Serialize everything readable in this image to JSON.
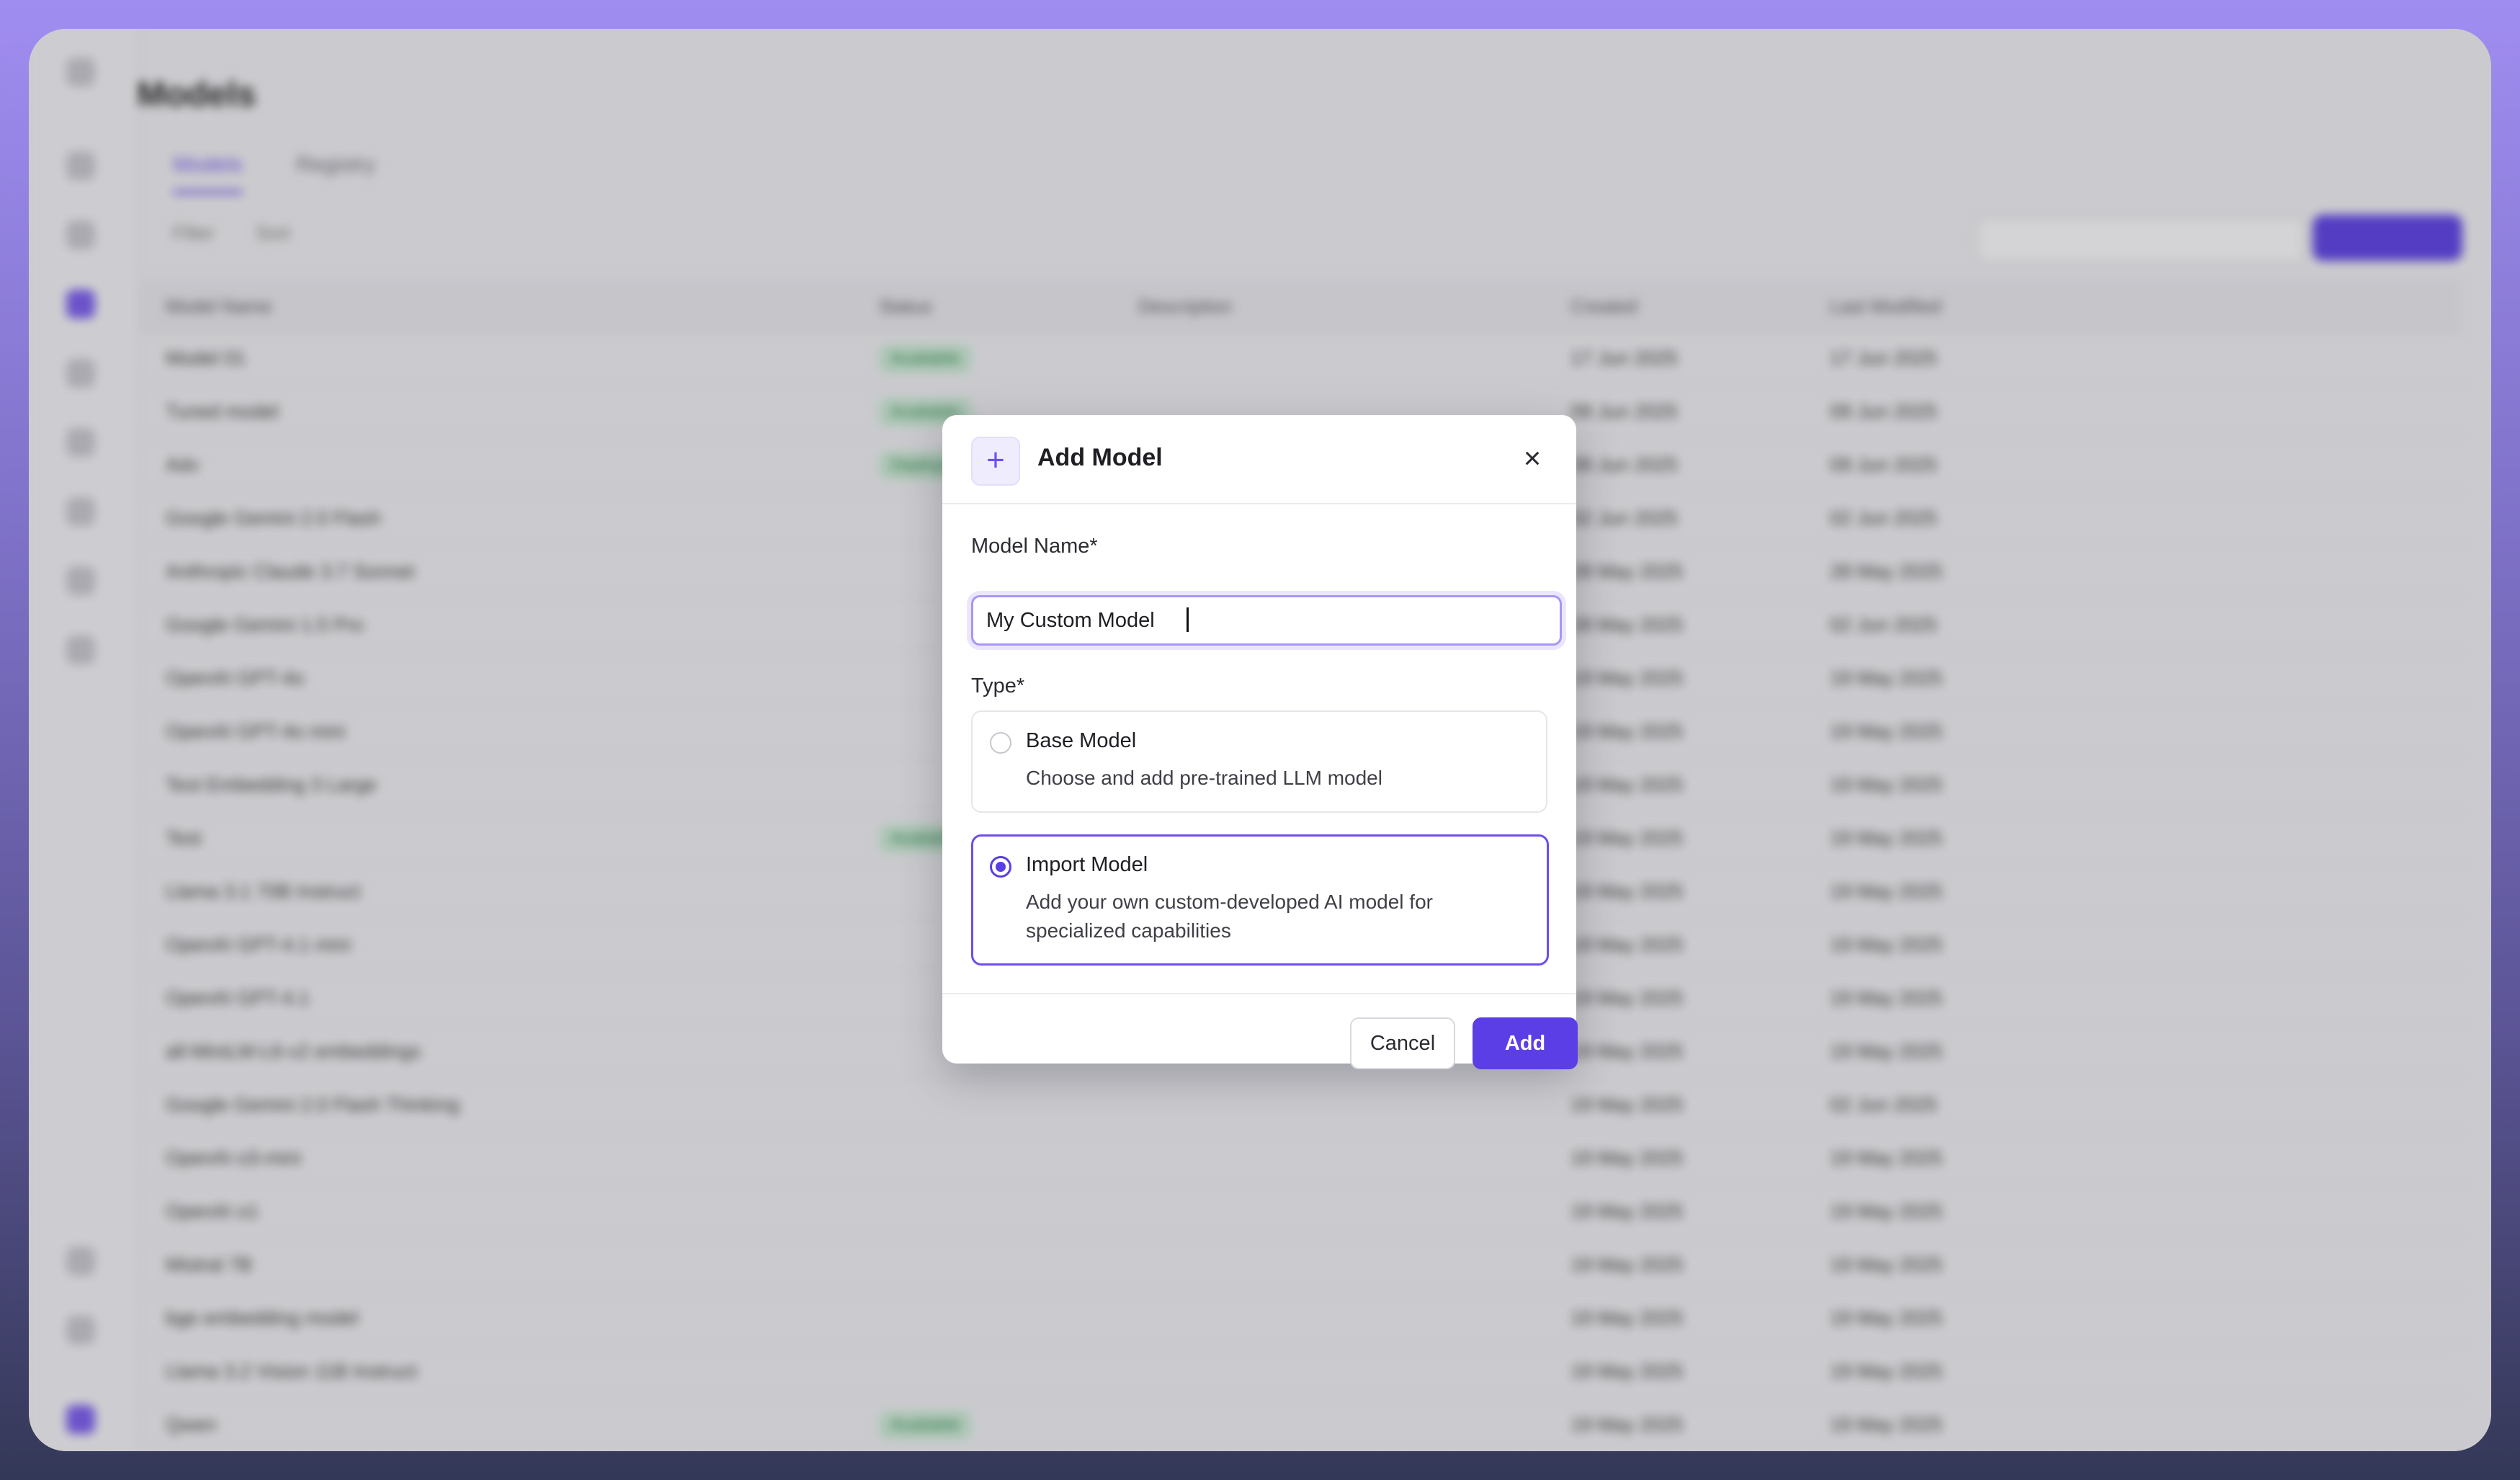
{
  "background_app": {
    "page_title": "Models",
    "tabs": [
      "Models",
      "Registry"
    ],
    "toolbar": [
      "Filter",
      "Sort"
    ],
    "columns": [
      "Model Name",
      "Status",
      "Description",
      "Created",
      "Last Modified"
    ],
    "rows": [
      {
        "name": "Model 01",
        "badge": "Available",
        "created": "17 Jun 2025",
        "modified": "17 Jun 2025"
      },
      {
        "name": "Tuned model",
        "badge": "Available",
        "created": "09 Jun 2025",
        "modified": "09 Jun 2025"
      },
      {
        "name": "Adv",
        "badge": "Deploying",
        "created": "09 Jun 2025",
        "modified": "09 Jun 2025"
      },
      {
        "name": "Google Gemini 2.0 Flash",
        "badge": "",
        "created": "02 Jun 2025",
        "modified": "02 Jun 2025"
      },
      {
        "name": "Anthropic Claude 3.7 Sonnet",
        "badge": "",
        "created": "28 May 2025",
        "modified": "28 May 2025"
      },
      {
        "name": "Google Gemini 1.5 Pro",
        "badge": "",
        "created": "28 May 2025",
        "modified": "02 Jun 2025"
      },
      {
        "name": "OpenAI GPT-4o",
        "badge": "",
        "created": "19 May 2025",
        "modified": "19 May 2025"
      },
      {
        "name": "OpenAI GPT-4o mini",
        "badge": "",
        "created": "19 May 2025",
        "modified": "19 May 2025"
      },
      {
        "name": "Text Embedding 3 Large",
        "badge": "",
        "created": "19 May 2025",
        "modified": "19 May 2025"
      },
      {
        "name": "Test",
        "badge": "Available",
        "created": "19 May 2025",
        "modified": "19 May 2025"
      },
      {
        "name": "Llama 3.1 70B Instruct",
        "badge": "",
        "created": "19 May 2025",
        "modified": "19 May 2025"
      },
      {
        "name": "OpenAI GPT-4.1 mini",
        "badge": "",
        "created": "19 May 2025",
        "modified": "19 May 2025"
      },
      {
        "name": "OpenAI GPT-4.1",
        "badge": "",
        "created": "19 May 2025",
        "modified": "19 May 2025"
      },
      {
        "name": "all-MiniLM-L6-v2 embeddings",
        "badge": "",
        "created": "19 May 2025",
        "modified": "19 May 2025"
      },
      {
        "name": "Google Gemini 2.0 Flash Thinking",
        "badge": "",
        "created": "19 May 2025",
        "modified": "02 Jun 2025"
      },
      {
        "name": "OpenAI o3-mini",
        "badge": "",
        "created": "19 May 2025",
        "modified": "19 May 2025"
      },
      {
        "name": "OpenAI o1",
        "badge": "",
        "created": "19 May 2025",
        "modified": "19 May 2025"
      },
      {
        "name": "Mistral 7B",
        "badge": "",
        "created": "19 May 2025",
        "modified": "19 May 2025"
      },
      {
        "name": "bge embedding model",
        "badge": "",
        "created": "19 May 2025",
        "modified": "19 May 2025"
      },
      {
        "name": "Llama 3.2 Vision 11B Instruct",
        "badge": "",
        "created": "19 May 2025",
        "modified": "19 May 2025"
      },
      {
        "name": "Qwen",
        "badge": "Available",
        "created": "19 May 2025",
        "modified": "19 May 2025"
      }
    ]
  },
  "dialog": {
    "title": "Add Model",
    "close_label": "×",
    "add_icon": "+",
    "model_name_label": "Model Name*",
    "model_name_value": "My Custom Model",
    "type_label": "Type*",
    "options": [
      {
        "title": "Base Model",
        "description": "Choose and add pre-trained LLM model",
        "selected": false
      },
      {
        "title": "Import Model",
        "description": "Add your own custom-developed AI model for specialized capabilities",
        "selected": true
      }
    ],
    "cancel_label": "Cancel",
    "add_label": "Add"
  },
  "colors": {
    "accent": "#5b3ee6",
    "accent_light": "#efedfd",
    "input_focus_border": "#a995f5"
  },
  "icons": [
    "plus-icon",
    "close-icon",
    "radio-unchecked-icon",
    "radio-checked-icon"
  ]
}
